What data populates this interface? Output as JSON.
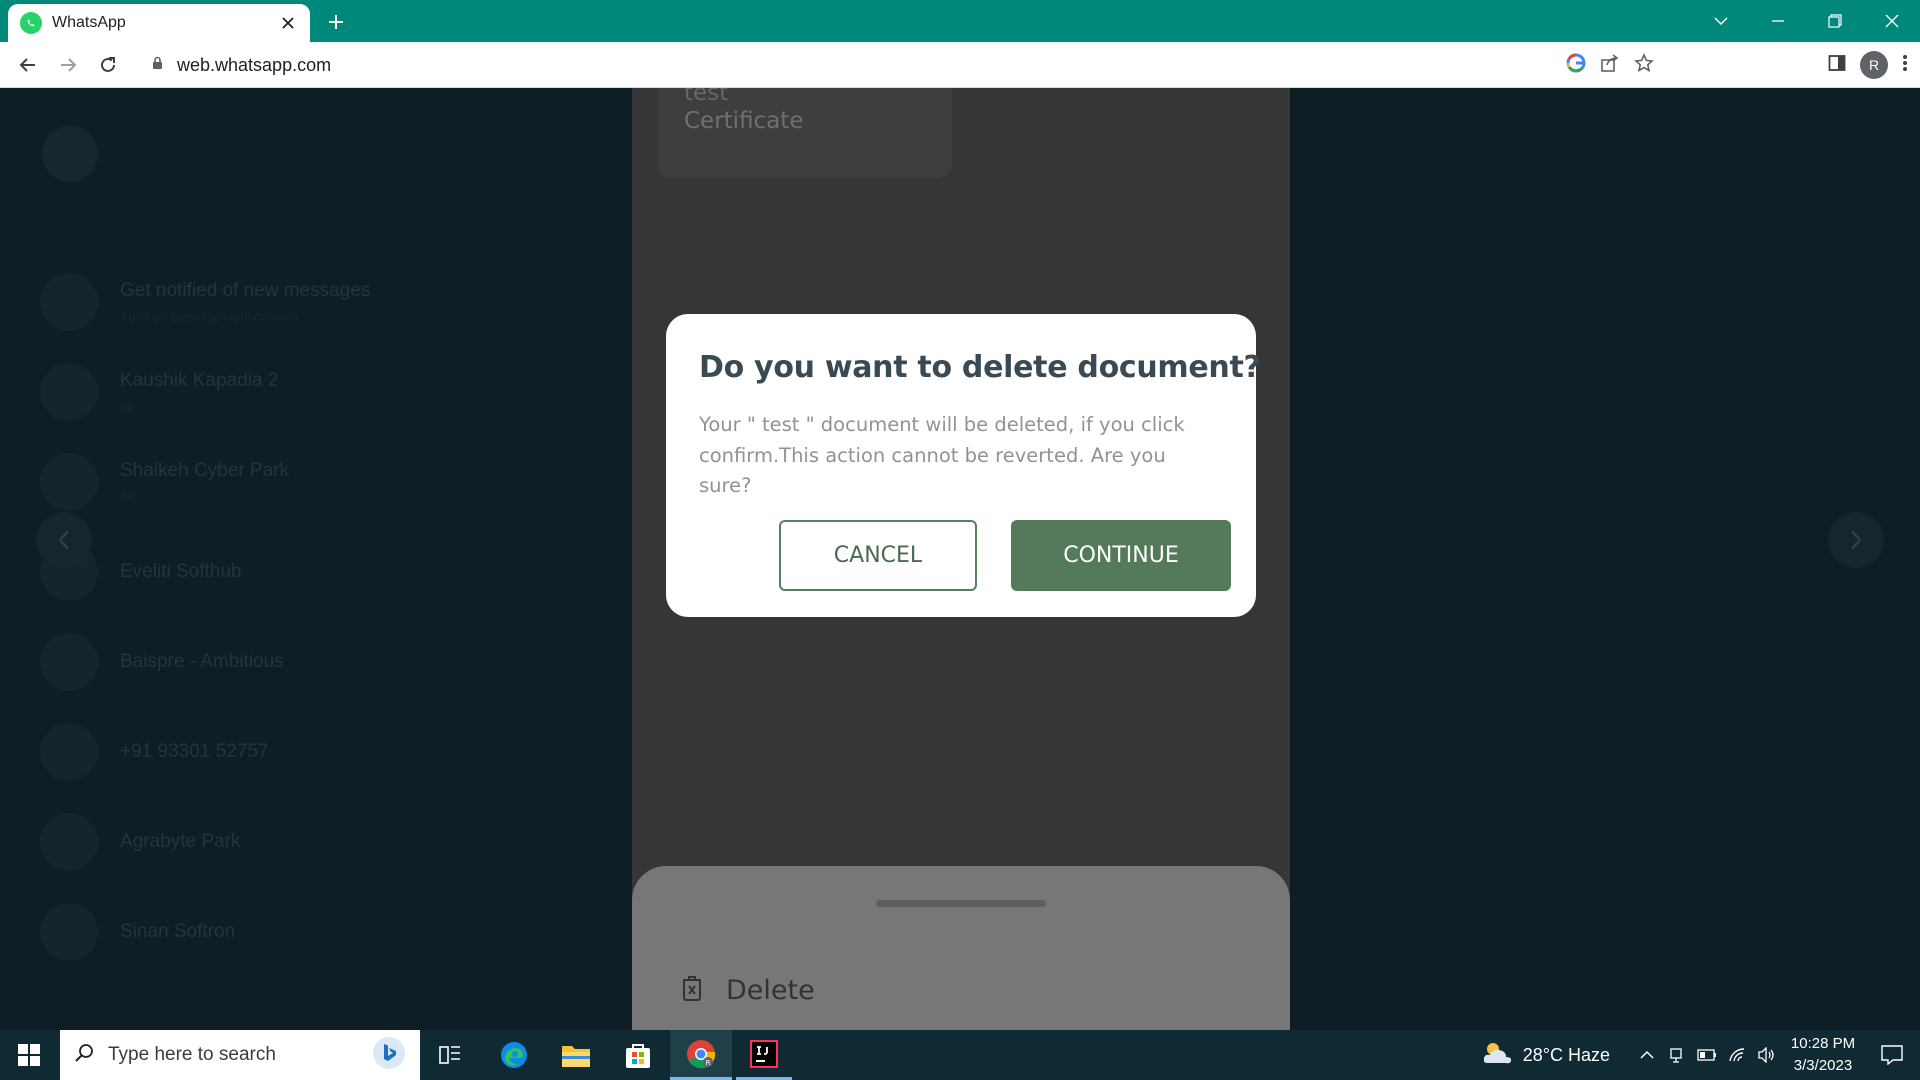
{
  "browser": {
    "tab_title": "WhatsApp",
    "url": "web.whatsapp.com",
    "profile_initial": "R"
  },
  "background_chats": [
    {
      "name": "Get notified of new messages",
      "sub": "Turn on desktop notifications"
    },
    {
      "name": "Kaushik Kapadia 2",
      "sub": "ok"
    },
    {
      "name": "Shaikeh Cyber Park",
      "sub": "ok"
    },
    {
      "name": "Eveliti Softhub",
      "sub": ""
    },
    {
      "name": "Baispre - Ambitious",
      "sub": ""
    },
    {
      "name": "+91 93301 52757",
      "sub": ""
    },
    {
      "name": "Agrabyte Park",
      "sub": ""
    },
    {
      "name": "Sinan Softron",
      "sub": ""
    }
  ],
  "viewer": {
    "doc_name_line1": "test",
    "doc_name_line2": "Certificate",
    "sheet_action_label": "Delete"
  },
  "dialog": {
    "title": "Do you want to delete document?",
    "message": "Your \" test \" document will be deleted, if you click confirm.This action cannot be reverted. Are you sure?",
    "cancel_label": "CANCEL",
    "continue_label": "CONTINUE"
  },
  "taskbar": {
    "search_placeholder": "Type here to search",
    "weather": "28°C  Haze",
    "time": "10:28 PM",
    "date": "3/3/2023"
  },
  "colors": {
    "tab_bar": "#00897b",
    "primary_button": "#557a5b",
    "dialog_title": "#3a4a55"
  }
}
